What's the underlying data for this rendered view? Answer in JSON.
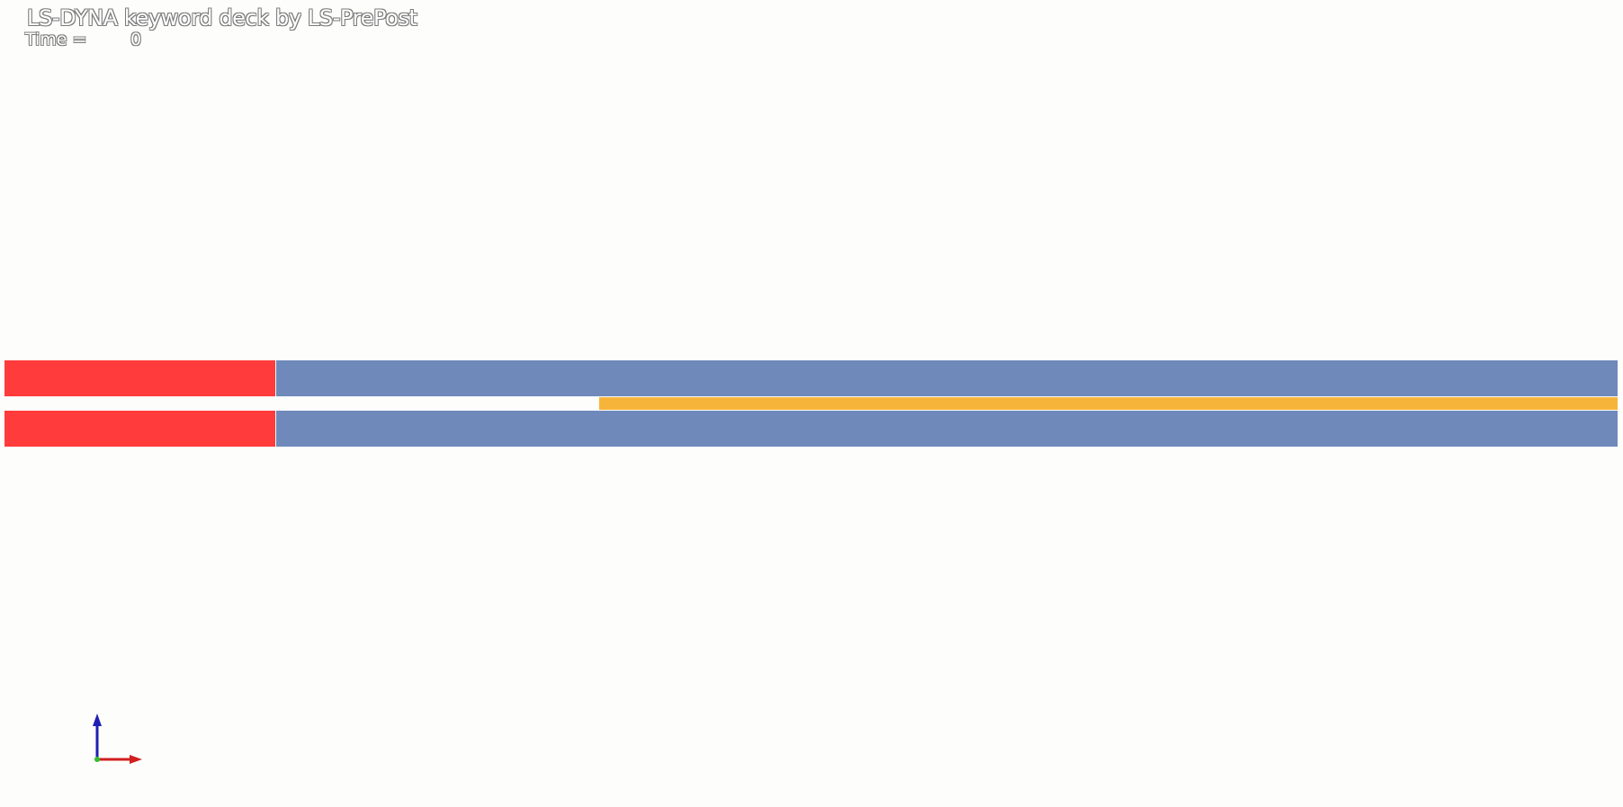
{
  "viewer": {
    "title": "LS-DYNA keyword deck by LS-PrePost",
    "time_label": "Time =",
    "time_value": "0"
  },
  "model": {
    "parts": [
      {
        "name": "red-top-block",
        "color": "#ff3b3b"
      },
      {
        "name": "blue-top-block",
        "color": "#6f89bb"
      },
      {
        "name": "orange-strip",
        "color": "#f6b53a"
      },
      {
        "name": "red-bottom-block",
        "color": "#ff3b3b"
      },
      {
        "name": "blue-bottom-block",
        "color": "#6f89bb"
      }
    ]
  },
  "triad": {
    "axes": [
      {
        "name": "y-axis-arrow",
        "color": "#1f1fb4"
      },
      {
        "name": "x-axis-arrow",
        "color": "#d11f1f"
      },
      {
        "name": "z-axis-dot",
        "color": "#2fbf2f"
      }
    ]
  }
}
